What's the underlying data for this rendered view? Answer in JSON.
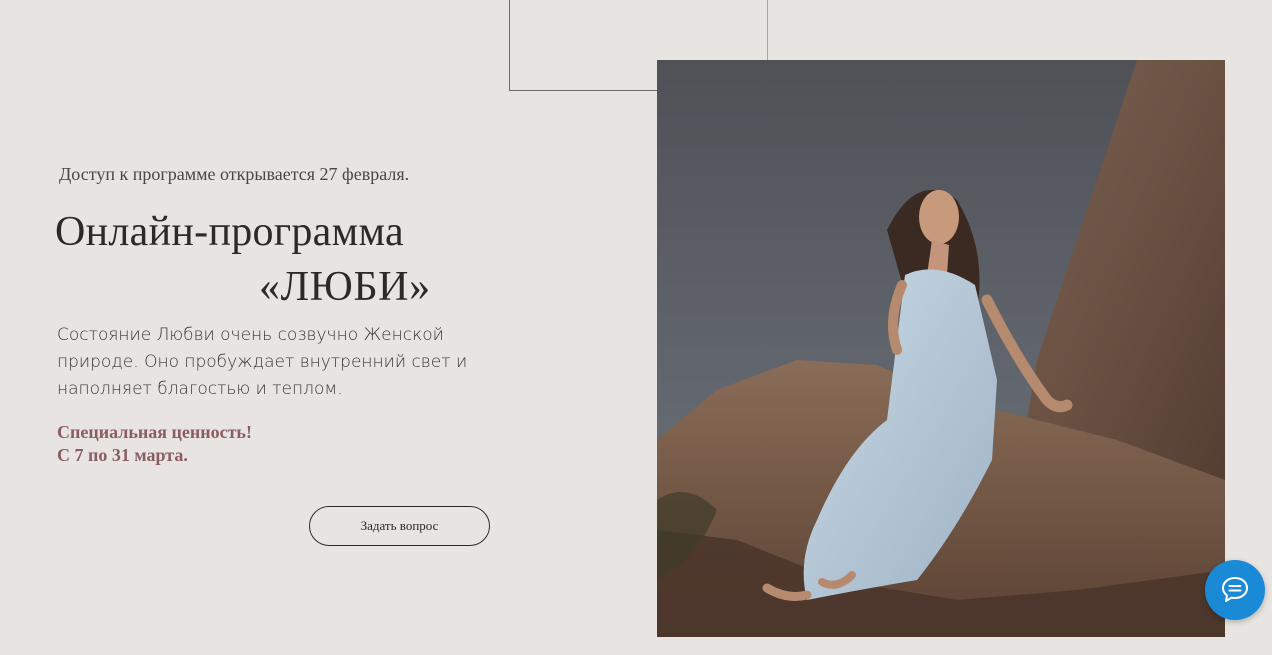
{
  "hero": {
    "access_note": "Доступ к программе открывается 27 февраля.",
    "title_line1": "Онлайн-программа",
    "title_line2": "«ЛЮБИ»",
    "description": "Состояние Любви очень созвучно Женской природе. Оно пробуждает внутренний свет и наполняет благостью и теплом.",
    "special_line1": "Специальная ценность!",
    "special_line2": "С 7 по 31 марта.",
    "ask_button_label": "Задать вопрос"
  },
  "photo": {
    "subject": "woman in light blue dress sitting on rocks"
  },
  "chat_widget": {
    "icon": "chat-bubble-icon"
  },
  "colors": {
    "background": "#e8e4e1",
    "text": "#2c2a28",
    "accent": "#8a5d61",
    "chat_button": "#1a8ad6"
  }
}
